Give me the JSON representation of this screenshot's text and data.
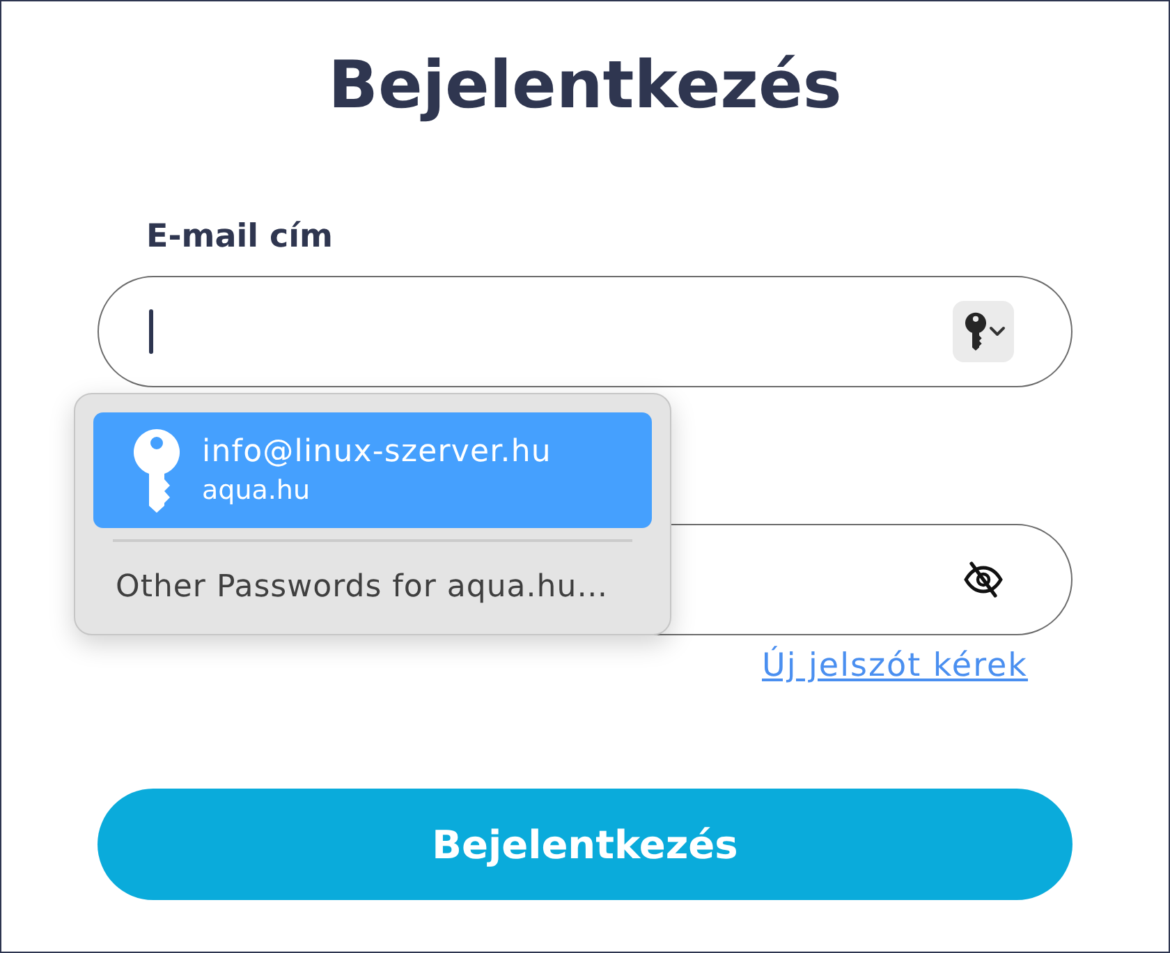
{
  "title": "Bejelentkezés",
  "email_field": {
    "label": "E-mail cím",
    "focused": true
  },
  "autofill_menu": {
    "open": true,
    "items": [
      {
        "kind": "credential",
        "username": "info@linux-szerver.hu",
        "site": "aqua.hu",
        "selected": true
      },
      {
        "kind": "action",
        "label": "Other Passwords for aqua.hu…",
        "selected": false
      }
    ]
  },
  "password_field": {
    "password_visible": false
  },
  "forgot_password_link": "Új jelszót kérek",
  "submit_button": {
    "label": "Bejelentkezés"
  }
}
